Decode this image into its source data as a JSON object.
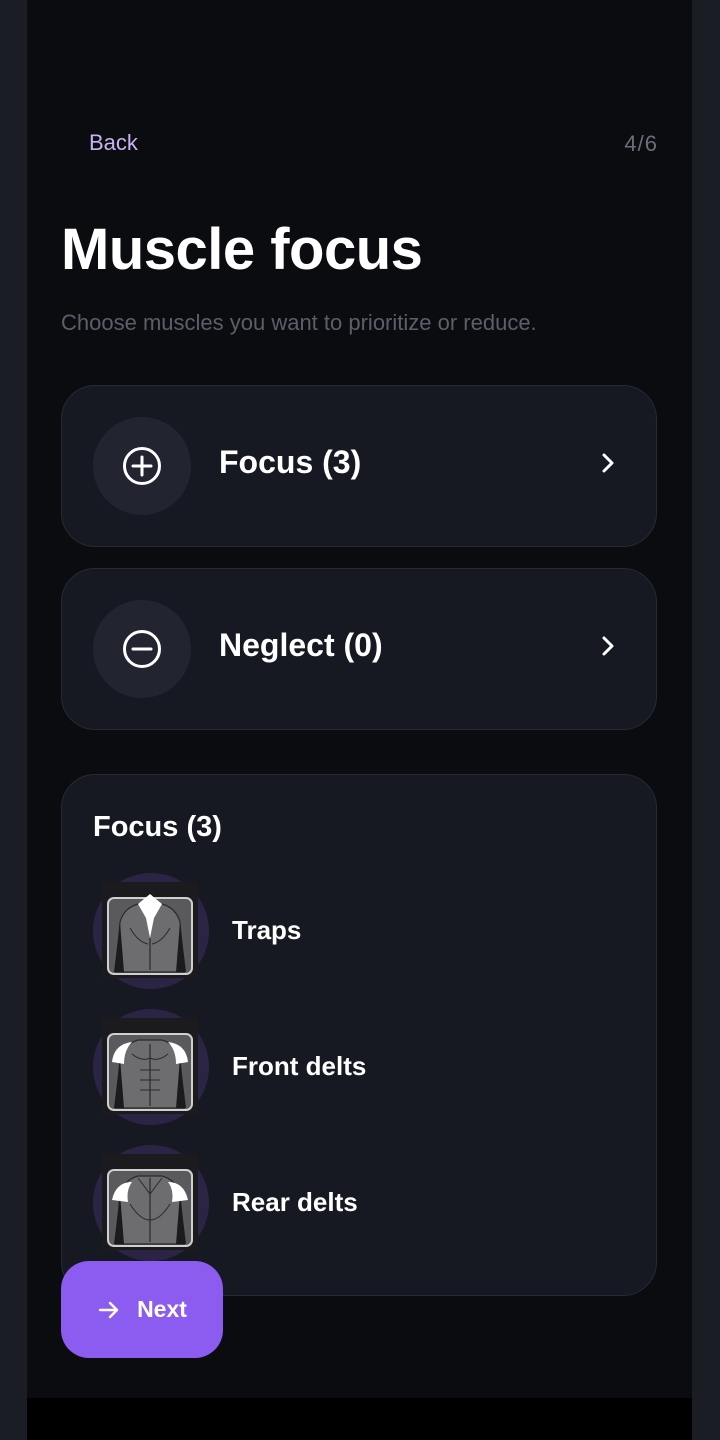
{
  "header": {
    "back_label": "Back",
    "step": "4/6"
  },
  "title": "Muscle focus",
  "subtitle": "Choose muscles you want to prioritize or reduce.",
  "options": {
    "focus_label": "Focus (3)",
    "neglect_label": "Neglect (0)"
  },
  "focus_list": {
    "title": "Focus (3)",
    "items": [
      {
        "name": "Traps",
        "icon": "traps-body-icon"
      },
      {
        "name": "Front delts",
        "icon": "front-delts-body-icon"
      },
      {
        "name": "Rear delts",
        "icon": "rear-delts-body-icon"
      }
    ]
  },
  "next_label": "Next",
  "colors": {
    "background": "#0b0c10",
    "card": "#171922",
    "accent": "#8c5cf0",
    "back_link": "#c6b3f2",
    "muscle_circle": "#2c2445"
  }
}
